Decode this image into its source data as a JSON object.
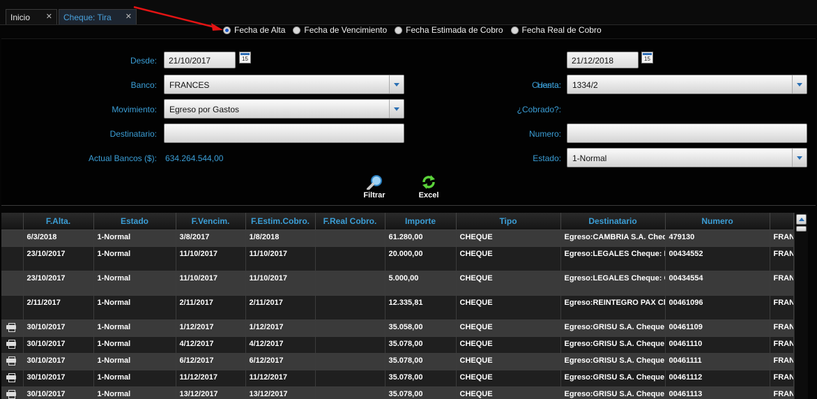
{
  "tabs": [
    {
      "label": "Inicio"
    },
    {
      "label": "Cheque: Tira"
    }
  ],
  "radios": [
    {
      "label": "Fecha de Alta",
      "selected": true
    },
    {
      "label": "Fecha de Vencimiento",
      "selected": false
    },
    {
      "label": "Fecha Estimada de Cobro",
      "selected": false
    },
    {
      "label": "Fecha Real de Cobro",
      "selected": false
    }
  ],
  "form": {
    "desde_label": "Desde:",
    "desde_value": "21/10/2017",
    "hasta_value": "21/12/2018",
    "banco_label": "Banco:",
    "banco_value": "FRANCES",
    "cuenta_label": "Cuenta:",
    "hasta_label": "Hasta:",
    "cuenta_value": "1334/2",
    "movimiento_label": "Movimiento:",
    "movimiento_value": "Egreso por Gastos",
    "cobrado_label": "¿Cobrado?:",
    "destinatario_label": "Destinatario:",
    "destinatario_value": "",
    "numero_label": "Numero:",
    "numero_value": "",
    "actual_bancos_label": "Actual Bancos ($):",
    "actual_bancos_value": "634.264.544,00",
    "estado_label": "Estado:",
    "estado_value": "1-Normal",
    "calendar_day": "15"
  },
  "toolbar": {
    "filtrar_label": "Filtrar",
    "excel_label": "Excel"
  },
  "grid": {
    "columns": [
      "F.Alta.",
      "Estado",
      "F.Vencim.",
      "F.Estim.Cobro.",
      "F.Real Cobro.",
      "Importe",
      "Tipo",
      "Destinatario",
      "Numero",
      ""
    ],
    "rows": [
      {
        "print": false,
        "cells": [
          "6/3/2018",
          "1-Normal",
          "3/8/2017",
          "1/8/2018",
          "",
          "61.280,00",
          "CHEQUE",
          "Egreso:CAMBRIA S.A. Cheque",
          "479130",
          "FRANC"
        ]
      },
      {
        "print": false,
        "cells": [
          "23/10/2017",
          "1-Normal",
          "11/10/2017",
          "11/10/2017",
          "",
          "20.000,00",
          "CHEQUE",
          "Egreso:LEGALES Cheque: LE",
          "00434552",
          "FRANC"
        ]
      },
      {
        "print": false,
        "cells": [
          "23/10/2017",
          "1-Normal",
          "11/10/2017",
          "11/10/2017",
          "",
          "5.000,00",
          "CHEQUE",
          "Egreso:LEGALES Cheque: GI",
          "00434554",
          "FRANC"
        ]
      },
      {
        "print": false,
        "cells": [
          "2/11/2017",
          "1-Normal",
          "2/11/2017",
          "2/11/2017",
          "",
          "12.335,81",
          "CHEQUE",
          "Egreso:REINTEGRO PAX Che",
          "00461096",
          "FRANC"
        ]
      },
      {
        "print": true,
        "cells": [
          "30/10/2017",
          "1-Normal",
          "1/12/2017",
          "1/12/2017",
          "",
          "35.058,00",
          "CHEQUE",
          "Egreso:GRISU S.A. Cheque:",
          "00461109",
          "FRANC"
        ]
      },
      {
        "print": true,
        "cells": [
          "30/10/2017",
          "1-Normal",
          "4/12/2017",
          "4/12/2017",
          "",
          "35.078,00",
          "CHEQUE",
          "Egreso:GRISU S.A. Cheque:",
          "00461110",
          "FRANC"
        ]
      },
      {
        "print": true,
        "cells": [
          "30/10/2017",
          "1-Normal",
          "6/12/2017",
          "6/12/2017",
          "",
          "35.078,00",
          "CHEQUE",
          "Egreso:GRISU S.A. Cheque:",
          "00461111",
          "FRANC"
        ]
      },
      {
        "print": true,
        "cells": [
          "30/10/2017",
          "1-Normal",
          "11/12/2017",
          "11/12/2017",
          "",
          "35.078,00",
          "CHEQUE",
          "Egreso:GRISU S.A. Cheque:",
          "00461112",
          "FRANC"
        ]
      },
      {
        "print": true,
        "cells": [
          "30/10/2017",
          "1-Normal",
          "13/12/2017",
          "13/12/2017",
          "",
          "35.078,00",
          "CHEQUE",
          "Egreso:GRISU S.A. Cheque:",
          "00461113",
          "FRANC"
        ]
      }
    ]
  }
}
